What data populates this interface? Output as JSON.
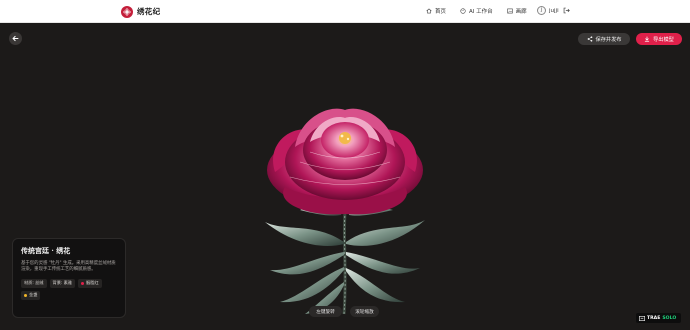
{
  "app": {
    "name": "绣花纪"
  },
  "nav": {
    "items": [
      {
        "label": "首页",
        "icon": "home-icon"
      },
      {
        "label": "AI 工作台",
        "icon": "palette-icon"
      },
      {
        "label": "画廊",
        "icon": "image-icon"
      }
    ]
  },
  "user": {
    "name": "jujji",
    "avatar_initial": "J"
  },
  "actions": {
    "save_label": "保存并发布",
    "export_label": "导出模型"
  },
  "info": {
    "title": "传统宫廷 · 绣花",
    "description": "基于您的灵感 \"牡丹\" 生成。采用高精度丝绒材质渲染，重现手工传统工艺的细腻质感。",
    "tags": [
      {
        "label": "材质: 丝绒",
        "dot": ""
      },
      {
        "label": "背景: 素雅",
        "dot": ""
      },
      {
        "label": "胭脂红",
        "dot": "#e0204a"
      },
      {
        "label": "金盏",
        "dot": "#f0b429"
      }
    ]
  },
  "hints": {
    "rotate": "左键旋转",
    "zoom": "滚轮缩放"
  },
  "watermark": {
    "part1": "TRAE",
    "part2": "SOLO"
  },
  "colors": {
    "accent": "#e0204a",
    "brand": "#c41e3a",
    "canvas": "#1c1a19"
  }
}
